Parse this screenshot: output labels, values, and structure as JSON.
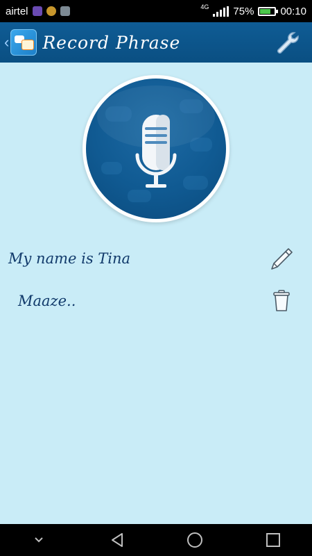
{
  "status_bar": {
    "carrier": "airtel",
    "network": "4G",
    "battery_percent": "75%",
    "battery_level": 0.75,
    "time": "00:10",
    "notification_icons": [
      "image-icon",
      "h-app-icon",
      "play-store-icon"
    ]
  },
  "app_bar": {
    "title": "Record Phrase",
    "back_icon": "chevron-left-icon",
    "logo_icon": "app-logo-icon",
    "settings_icon": "wrench-icon"
  },
  "record_button": {
    "icon": "microphone-icon"
  },
  "phrases": [
    {
      "text": "My name is Tina",
      "action_icon": "pencil-icon"
    },
    {
      "text": "Maaze..",
      "action_icon": "trash-icon"
    }
  ],
  "nav_bar": {
    "icons": [
      "hide-keyboard-icon",
      "back-triangle-icon",
      "home-circle-icon",
      "recents-square-icon"
    ]
  },
  "colors": {
    "app_bar": "#0f5c95",
    "background": "#c9ecf7",
    "text": "#113a6b",
    "mic_circle": "#105a92"
  }
}
